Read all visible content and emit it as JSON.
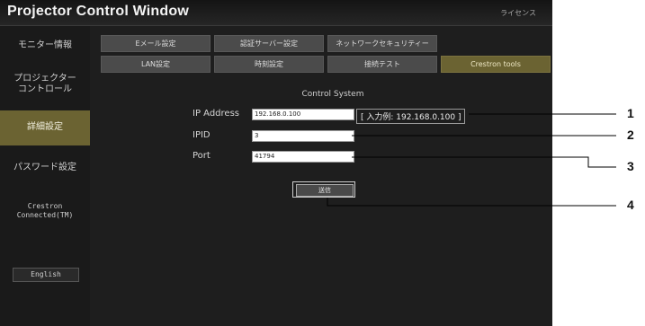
{
  "window": {
    "title": "Projector Control Window",
    "license_link": "ライセンス"
  },
  "sidebar": {
    "items": [
      {
        "label": "モニター情報",
        "active": false
      },
      {
        "label": "プロジェクター\nコントロール",
        "active": false
      },
      {
        "label": "詳細設定",
        "active": true
      },
      {
        "label": "パスワード設定",
        "active": false
      },
      {
        "label": "Crestron\nConnected(TM)",
        "active": false
      }
    ],
    "english_button": "English"
  },
  "tabs": {
    "row1": [
      "Eメール設定",
      "認証サーバー設定",
      "ネットワークセキュリティー"
    ],
    "row2": [
      "LAN設定",
      "時刻設定",
      "接続テスト",
      "Crestron tools"
    ],
    "active": "Crestron tools"
  },
  "form": {
    "title": "Control System",
    "ip_label": "IP Address",
    "ip_value": "192.168.0.100",
    "ip_hint": "[ 入力例: 192.168.0.100 ]",
    "ipid_label": "IPID",
    "ipid_value": "3",
    "port_label": "Port",
    "port_value": "41794",
    "apply_label": "送信"
  },
  "callouts": [
    "1",
    "2",
    "3",
    "4"
  ],
  "colors": {
    "background": "#1e1e1e",
    "active_tab": "#6b6332",
    "callout_line": "#000000"
  }
}
